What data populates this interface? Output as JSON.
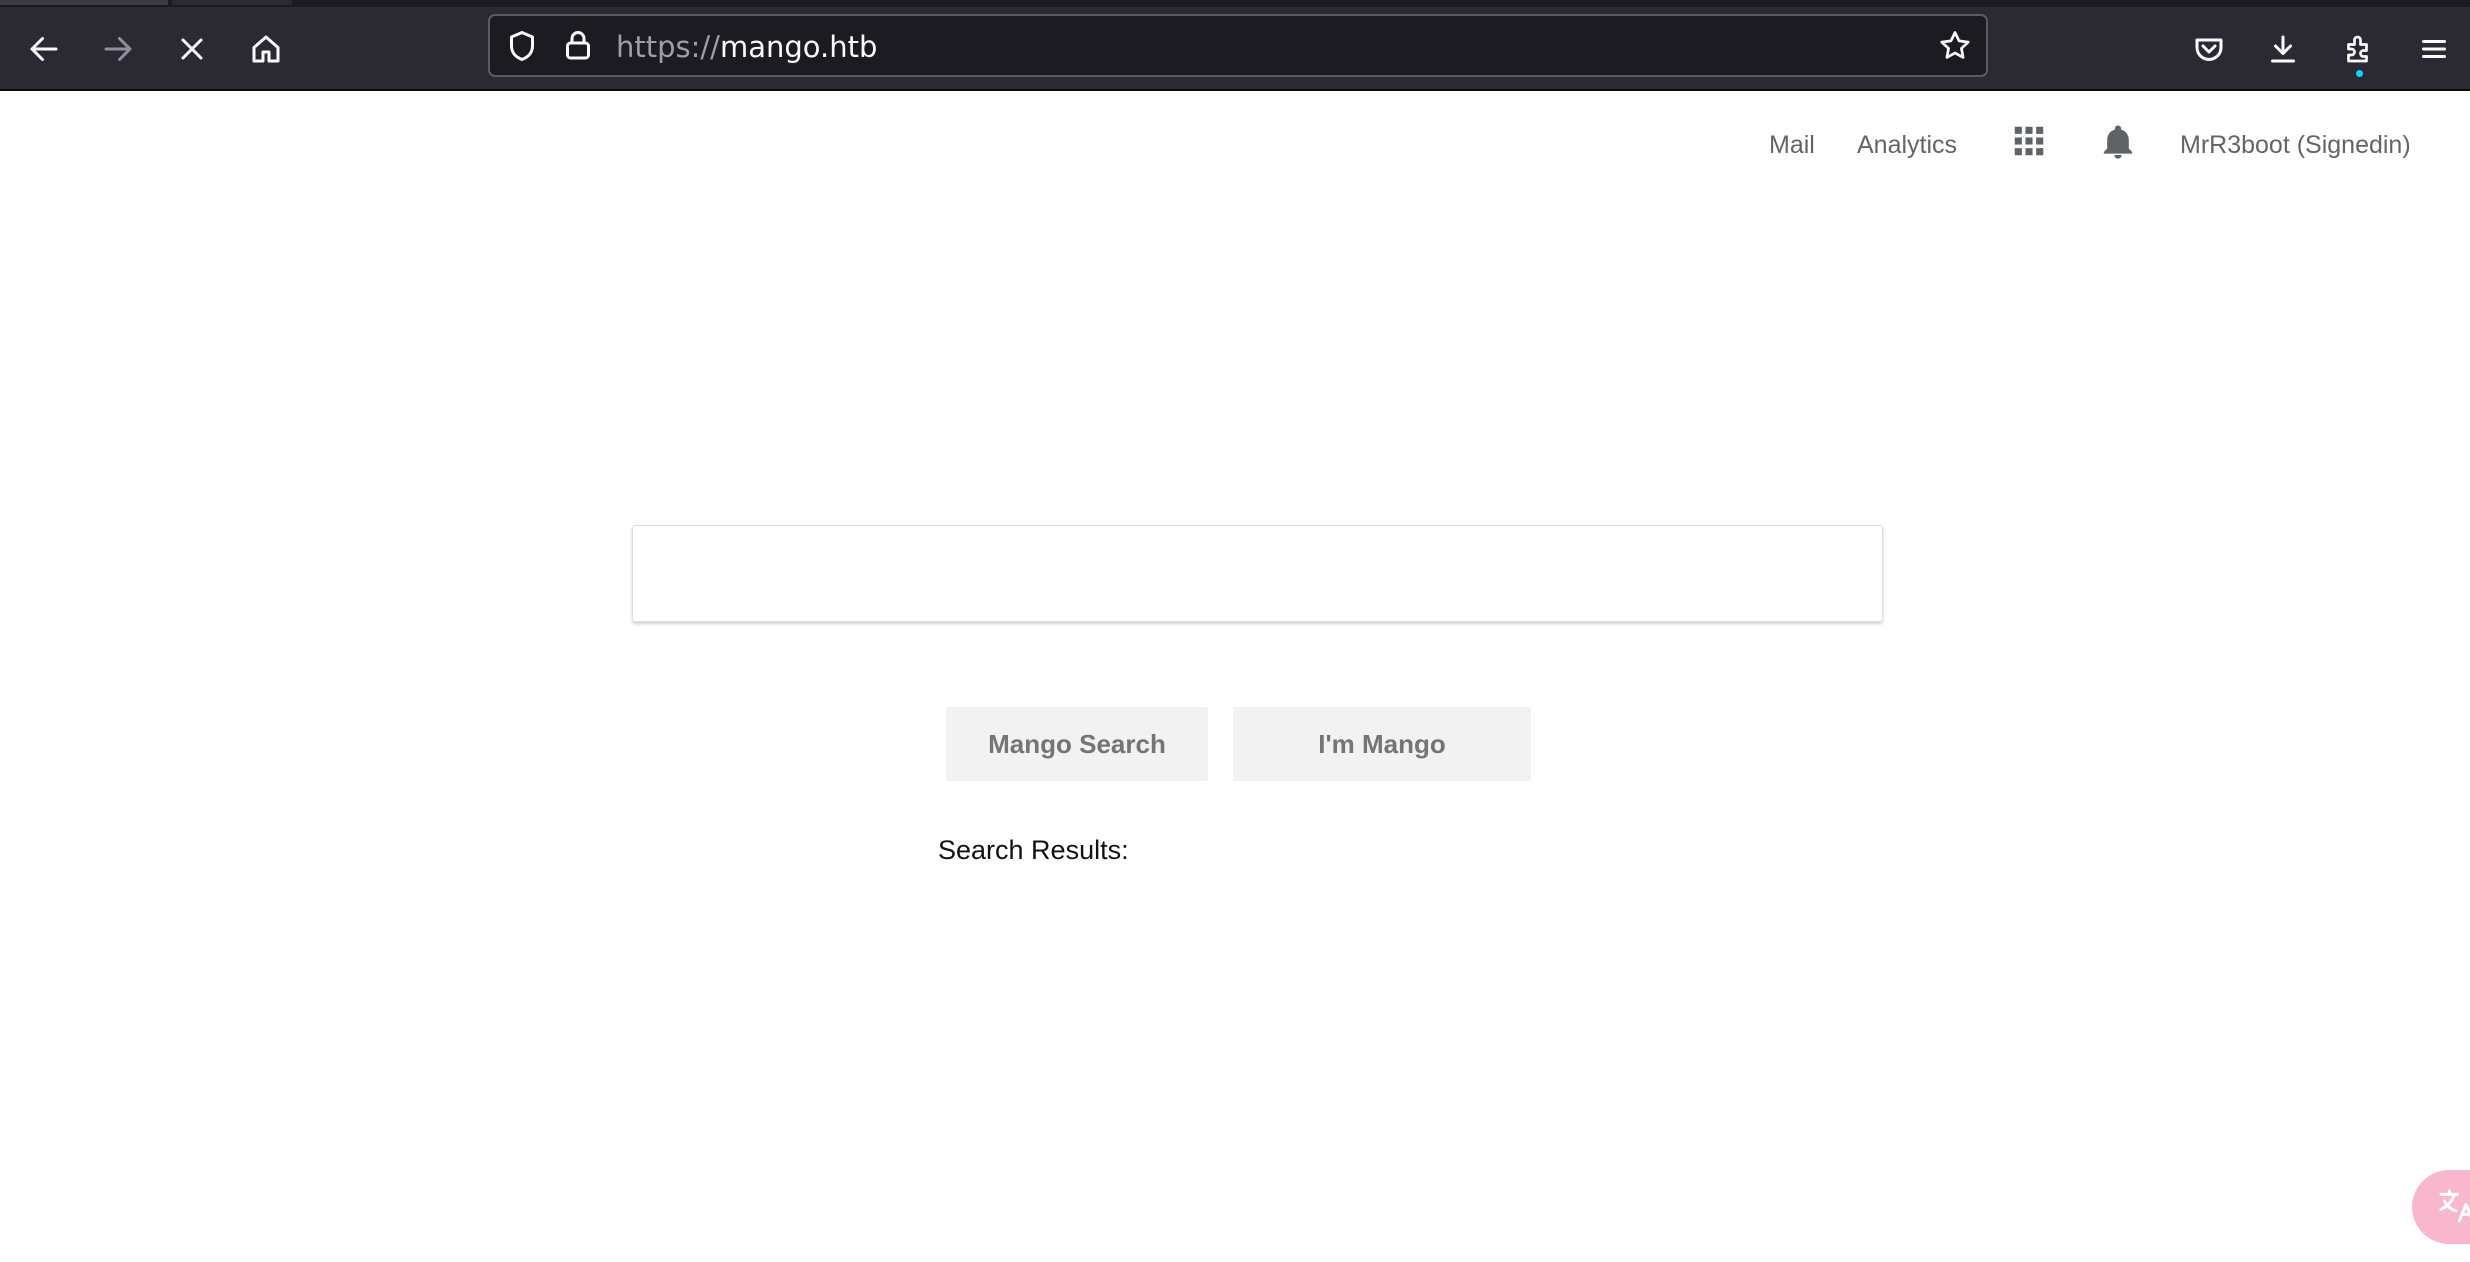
{
  "browser": {
    "url_scheme": "https://",
    "url_host": "mango.htb"
  },
  "nav": {
    "mail": "Mail",
    "analytics": "Analytics",
    "user": "MrR3boot (Signedin)"
  },
  "search": {
    "value": "",
    "placeholder": ""
  },
  "buttons": {
    "search": "Mango Search",
    "lucky": "I'm Mango"
  },
  "results": {
    "label": "Search Results:"
  },
  "icons": {
    "back": "back-arrow-icon",
    "forward": "forward-arrow-icon",
    "stop": "stop-icon",
    "home": "home-icon",
    "shield": "tracking-shield-icon",
    "lock": "lock-icon",
    "bookmark": "star-icon",
    "pocket": "pocket-icon",
    "downloads": "download-icon",
    "extensions": "extensions-icon",
    "menu": "hamburger-menu-icon",
    "apps": "apps-grid-icon",
    "notifications": "bell-icon",
    "translate": "translate-icon"
  },
  "colors": {
    "chrome_bg": "#2b2a33",
    "urlbar_bg": "#1c1b22",
    "button_bg": "#f2f2f2",
    "nav_text": "#646464"
  }
}
